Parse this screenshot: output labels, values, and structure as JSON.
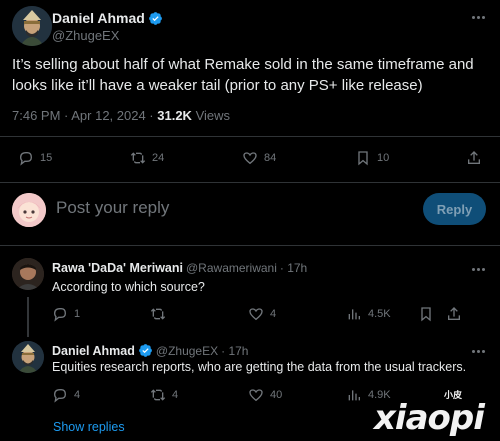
{
  "main_tweet": {
    "author_name": "Daniel Ahmad",
    "author_handle": "@ZhugeEX",
    "text": "It’s selling about half of what Remake sold in the same timeframe and looks like it’ll have a weaker tail (prior to any PS+ like release)",
    "time": "7:46 PM · Apr 12, 2024 · ",
    "views_count": "31.2K",
    "views_label": " Views",
    "actions": {
      "replies": "15",
      "reposts": "24",
      "likes": "84",
      "bookmarks": "10"
    }
  },
  "compose": {
    "placeholder": "Post your reply",
    "reply_button": "Reply"
  },
  "replies": [
    {
      "author_name": "Rawa 'DaDa' Meriwani",
      "author_handle": "@Rawameriwani",
      "time": " · 17h",
      "text": "According to which source?",
      "actions": {
        "replies": "1",
        "reposts": "",
        "likes": "4",
        "views": "4.5K"
      }
    },
    {
      "author_name": "Daniel Ahmad",
      "author_handle": "@ZhugeEX",
      "time": " · 17h",
      "text": "Equities research reports, who are getting the data from the usual trackers.",
      "actions": {
        "replies": "4",
        "reposts": "4",
        "likes": "40",
        "views": "4.9K"
      }
    }
  ],
  "show_replies": "Show replies",
  "watermark": {
    "main": "xiaopi",
    "small": "小皮"
  },
  "colors": {
    "background": "#000000",
    "text": "#e7e9ea",
    "muted": "#71767b",
    "accent": "#1d9bf0",
    "divider": "#2f3336"
  }
}
